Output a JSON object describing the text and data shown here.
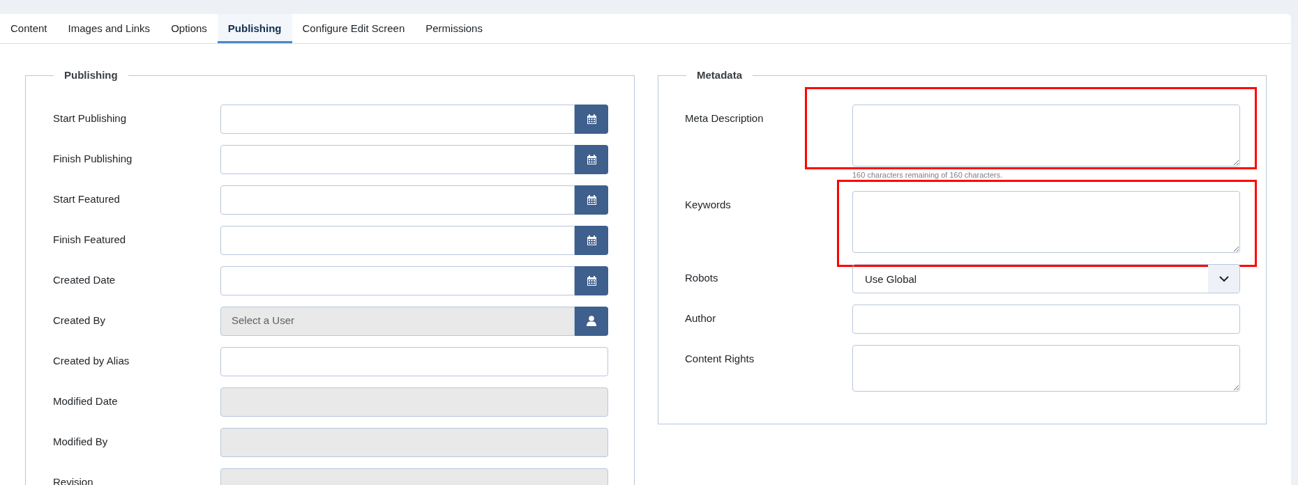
{
  "tabs": [
    {
      "label": "Content",
      "selected": false
    },
    {
      "label": "Images and Links",
      "selected": false
    },
    {
      "label": "Options",
      "selected": false
    },
    {
      "label": "Publishing",
      "selected": true
    },
    {
      "label": "Configure Edit Screen",
      "selected": false
    },
    {
      "label": "Permissions",
      "selected": false
    }
  ],
  "publishing": {
    "legend": "Publishing",
    "fields": [
      {
        "label": "Start Publishing",
        "kind": "date"
      },
      {
        "label": "Finish Publishing",
        "kind": "date"
      },
      {
        "label": "Start Featured",
        "kind": "date"
      },
      {
        "label": "Finish Featured",
        "kind": "date"
      },
      {
        "label": "Created Date",
        "kind": "date"
      },
      {
        "label": "Created By",
        "kind": "user",
        "placeholder": "Select a User"
      },
      {
        "label": "Created by Alias",
        "kind": "text"
      },
      {
        "label": "Modified Date",
        "kind": "readonly"
      },
      {
        "label": "Modified By",
        "kind": "readonly"
      },
      {
        "label": "Revision",
        "kind": "readonly"
      }
    ]
  },
  "metadata": {
    "legend": "Metadata",
    "fields": [
      {
        "label": "Meta Description",
        "kind": "textarea",
        "hint": "160 characters remaining of 160 characters.",
        "highlighted": true
      },
      {
        "label": "Keywords",
        "kind": "textarea",
        "highlighted": true
      },
      {
        "label": "Robots",
        "kind": "select",
        "value": "Use Global",
        "highlighted": false
      },
      {
        "label": "Author",
        "kind": "text",
        "highlighted": false
      },
      {
        "label": "Content Rights",
        "kind": "textarea",
        "highlighted": false
      }
    ]
  }
}
